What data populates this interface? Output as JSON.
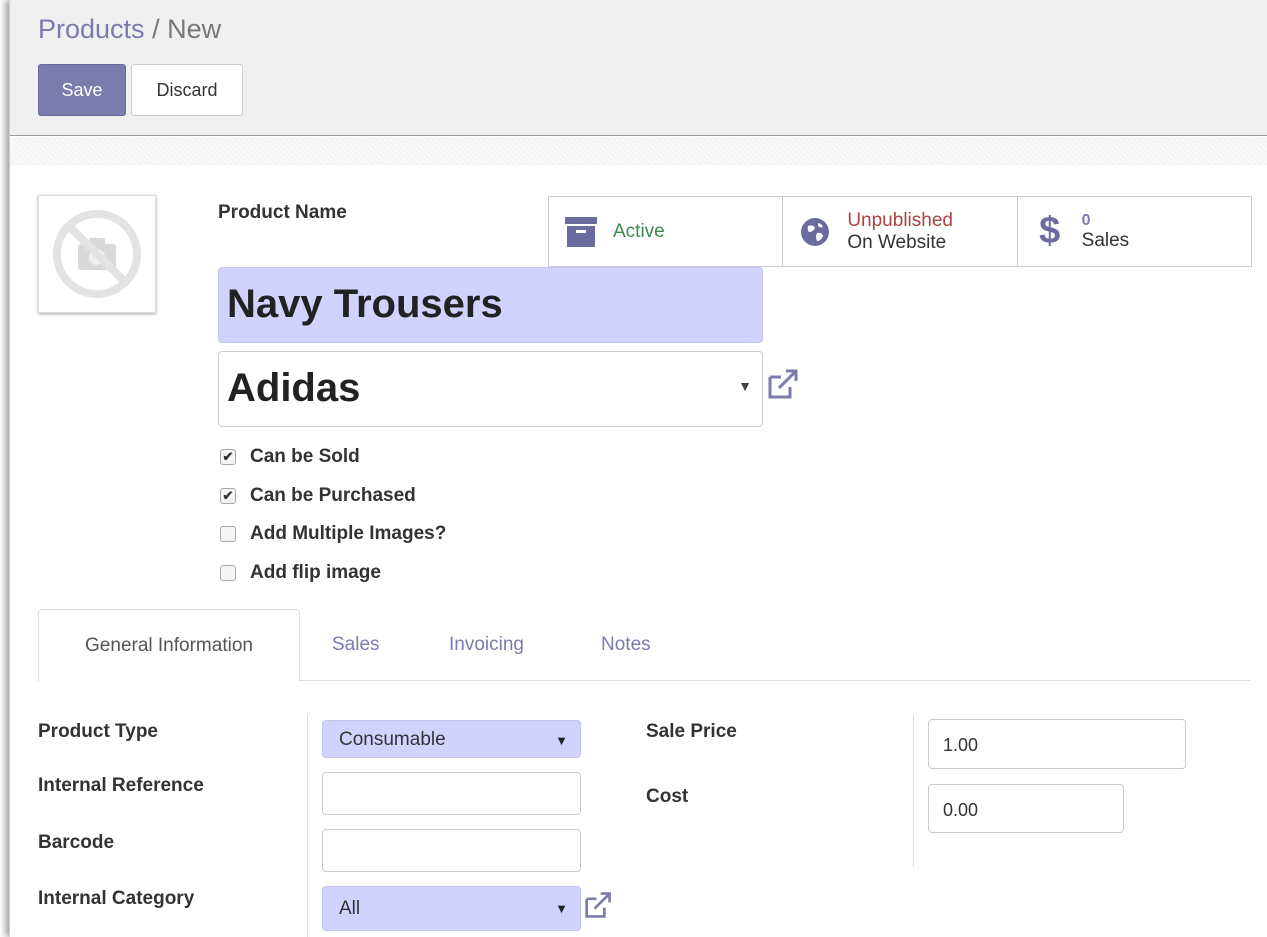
{
  "breadcrumb": {
    "parent": "Products",
    "separator": "/",
    "current": "New"
  },
  "toolbar": {
    "save_label": "Save",
    "discard_label": "Discard"
  },
  "form": {
    "name_label": "Product Name",
    "name_value": "Navy Trousers",
    "brand_value": "Adidas",
    "smart_buttons": [
      {
        "icon": "archive-icon",
        "line1": "Active",
        "line1_color": "#3c8a4e"
      },
      {
        "icon": "globe-icon",
        "line1": "Unpublished",
        "line1_color": "#a94442",
        "line2": "On Website"
      },
      {
        "icon": "dollar-icon",
        "line1": "0",
        "line2": "Sales"
      }
    ],
    "checkboxes": [
      {
        "label": "Can be Sold",
        "checked": true
      },
      {
        "label": "Can be Purchased",
        "checked": true
      },
      {
        "label": "Add Multiple Images?",
        "checked": false
      },
      {
        "label": "Add flip image",
        "checked": false
      }
    ]
  },
  "tabs": [
    {
      "label": "General Information",
      "active": true
    },
    {
      "label": "Sales",
      "active": false
    },
    {
      "label": "Invoicing",
      "active": false
    },
    {
      "label": "Notes",
      "active": false
    }
  ],
  "general": {
    "product_type_label": "Product Type",
    "product_type_value": "Consumable",
    "internal_reference_label": "Internal Reference",
    "internal_reference_value": "",
    "barcode_label": "Barcode",
    "barcode_value": "",
    "internal_category_label": "Internal Category",
    "internal_category_value": "All",
    "sale_price_label": "Sale Price",
    "sale_price_value": "1.00",
    "cost_label": "Cost",
    "cost_value": "0.00"
  },
  "colors": {
    "accent": "#7c7bad",
    "required_bg": "#d2d2ff",
    "active_green": "#3c8a4e",
    "unpublished_red": "#a94442"
  }
}
